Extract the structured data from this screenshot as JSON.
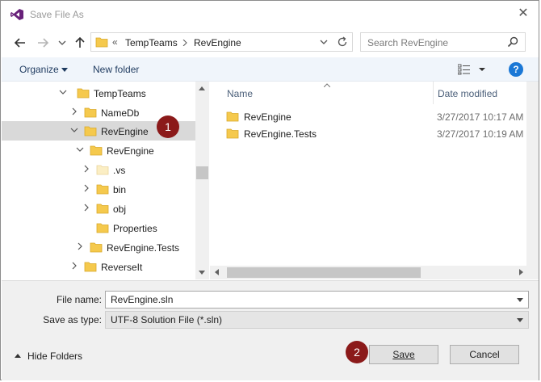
{
  "window": {
    "title": "Save File As",
    "close_glyph": "✕"
  },
  "nav": {
    "breadcrumb_prefix": "«",
    "breadcrumbs": [
      "TempTeams",
      "RevEngine"
    ],
    "search_placeholder": "Search RevEngine"
  },
  "toolbar": {
    "organize_label": "Organize",
    "new_folder_label": "New folder",
    "help_label": "?"
  },
  "tree": {
    "items": [
      {
        "label": "TempTeams"
      },
      {
        "label": "NameDb"
      },
      {
        "label": "RevEngine"
      },
      {
        "label": "RevEngine"
      },
      {
        "label": ".vs"
      },
      {
        "label": "bin"
      },
      {
        "label": "obj"
      },
      {
        "label": "Properties"
      },
      {
        "label": "RevEngine.Tests"
      },
      {
        "label": "ReverseIt"
      }
    ]
  },
  "files": {
    "columns": {
      "name": "Name",
      "date": "Date modified"
    },
    "rows": [
      {
        "name": "RevEngine",
        "date": "3/27/2017 10:17 AM"
      },
      {
        "name": "RevEngine.Tests",
        "date": "3/27/2017 10:19 AM"
      }
    ]
  },
  "form": {
    "file_name_label": "File name:",
    "file_name_value": "RevEngine.sln",
    "save_type_label": "Save as type:",
    "save_type_value": "UTF-8 Solution File (*.sln)"
  },
  "footer": {
    "hide_folders_label": "Hide Folders",
    "save_label": "Save",
    "cancel_label": "Cancel"
  },
  "markers": [
    "1",
    "2"
  ],
  "colors": {
    "marker": "#8b1a1a",
    "folder": "#f5c94d",
    "selected_row": "#d9d9d9",
    "help": "#1b78d6"
  }
}
